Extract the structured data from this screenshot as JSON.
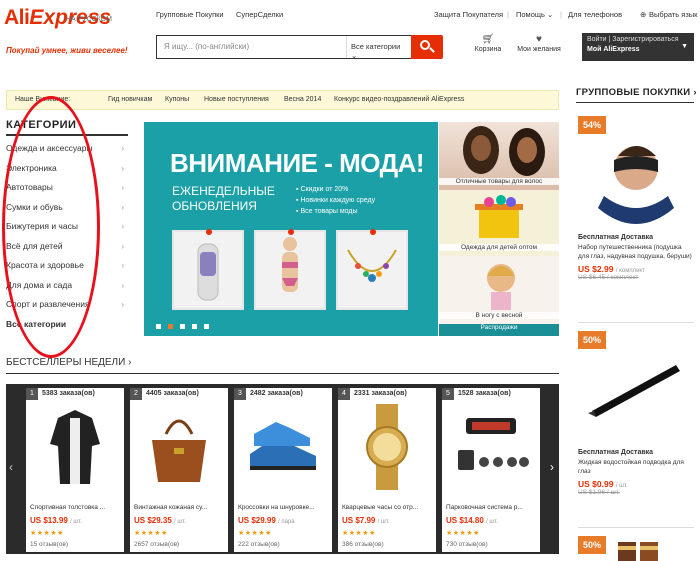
{
  "logo": {
    "brand_part1": "Ali",
    "brand_part2": "Express",
    "locale": "НА РУССКОМ",
    "slogan": "Покупай умнее, живи веселее!"
  },
  "topnav": {
    "links": [
      "Групповые Покупки",
      "СуперСделки"
    ],
    "right": [
      "Защита Покупателя",
      "Помощь ⌄",
      "Для телефонов",
      "Выбрать язык"
    ]
  },
  "search": {
    "placeholder": "Я ищу... (по-английски)",
    "category": "Все категории ⌄"
  },
  "header": {
    "cart_label": "Корзина",
    "wishlist_label": "Мои желания",
    "account_line1": "Войти | Зарегистрироваться",
    "account_line2": "Мой AliExpress"
  },
  "promobar": {
    "items": [
      "Наше Внимание:",
      "Гид новичкам",
      "Купоны",
      "Новые поступления",
      "Весна 2014",
      "Конкурс видео-поздравлений AliExpress"
    ]
  },
  "categories": {
    "title": "КАТЕГОРИИ",
    "items": [
      "Одежда и аксессуары",
      "Электроника",
      "Автотовары",
      "Сумки и обувь",
      "Бижутерия и часы",
      "Всё для детей",
      "Красота и здоровье",
      "Для дома и сада",
      "Спорт и развлечения"
    ],
    "all_label": "Все категории"
  },
  "banner": {
    "title": "ВНИМАНИЕ - МОДА!",
    "sub_line1": "ЕЖЕНЕДЕЛЬНЫЕ",
    "sub_line2": "ОБНОВЛЕНИЯ",
    "bullets": [
      "Скидки от 20%",
      "Новинки каждую среду",
      "Все товары моды"
    ]
  },
  "side_promos": {
    "p1": "Отличные товары для волос",
    "p2": "Одежда для детей оптом",
    "p3": "В ногу с весной",
    "p3b": "Распродажи"
  },
  "bestsellers": {
    "title": "БЕСТСЕЛЛЕРЫ НЕДЕЛИ ›",
    "items": [
      {
        "rank": "1",
        "orders": "5383 заказа(ов)",
        "name": "Спортивная толстовка ...",
        "price": "US $13.99",
        "unit": "/ шт.",
        "stars": "★★★★★",
        "reviews": "15 отзыв(ов)"
      },
      {
        "rank": "2",
        "orders": "4405 заказа(ов)",
        "name": "Винтажная кожаная су...",
        "price": "US $29.35",
        "unit": "/ шт.",
        "stars": "★★★★★",
        "reviews": "2657 отзыв(ов)"
      },
      {
        "rank": "3",
        "orders": "2482 заказа(ов)",
        "name": "Кроссовки на шнуровке...",
        "price": "US $29.99",
        "unit": "/ пара",
        "stars": "★★★★★",
        "reviews": "222 отзыв(ов)"
      },
      {
        "rank": "4",
        "orders": "2331 заказа(ов)",
        "name": "Кварцевые часы со отр...",
        "price": "US $7.99",
        "unit": "/ шт.",
        "stars": "★★★★★",
        "reviews": "386 отзыв(ов)"
      },
      {
        "rank": "5",
        "orders": "1528 заказа(ов)",
        "name": "Парковочная система р...",
        "price": "US $14.80",
        "unit": "/ шт.",
        "stars": "★★★★★",
        "reviews": "730 отзыв(ов)"
      }
    ]
  },
  "group_buy": {
    "title": "ГРУППОВЫЕ ПОКУПКИ ›",
    "items": [
      {
        "badge": "54%",
        "shipping": "Бесплатная Доставка",
        "desc": "Набор путешественника (подушка для глаз, надувная подушка, беруши)",
        "price": "US $2.99",
        "unit": "/ комплект",
        "old_price": "US $6.45 / комплект"
      },
      {
        "badge": "50%",
        "shipping": "Бесплатная Доставка",
        "desc": "Жидкая водостойкая подводка для глаз",
        "price": "US $0.99",
        "unit": "/ шт.",
        "old_price": "US $1.96 / шт."
      },
      {
        "badge": "50%"
      }
    ]
  },
  "colors": {
    "accent": "#e62e04",
    "badge": "#e87b2a",
    "banner": "#1aa0a6",
    "annotation": "#e8101a"
  }
}
